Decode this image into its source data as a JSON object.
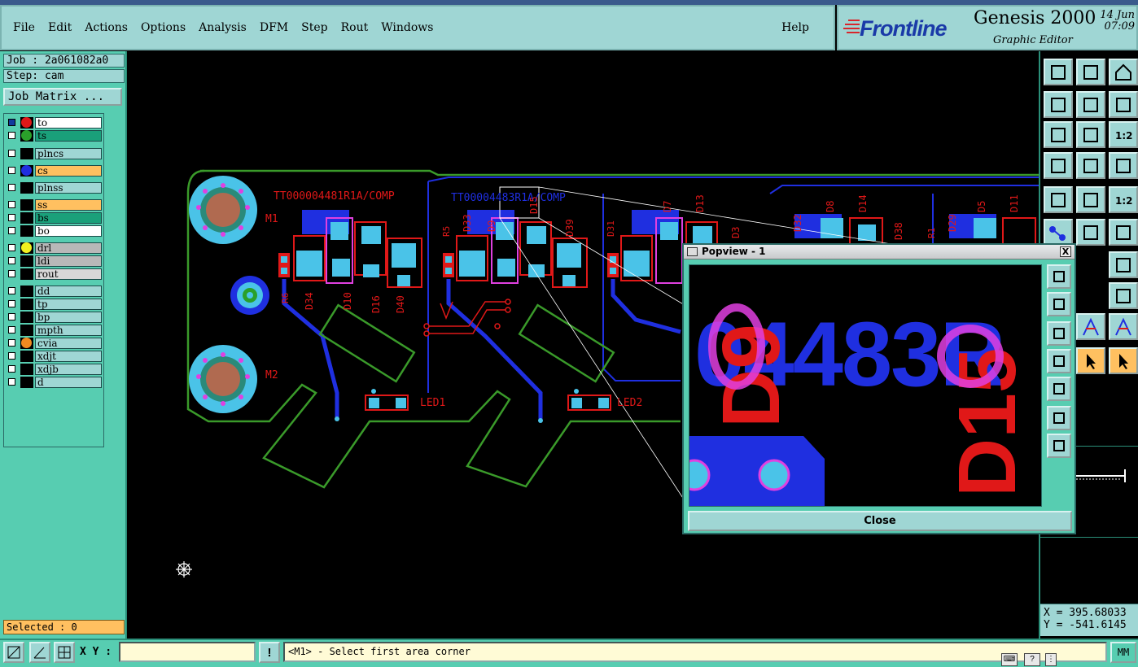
{
  "menu": {
    "items": [
      "File",
      "Edit",
      "Actions",
      "Options",
      "Analysis",
      "DFM",
      "Step",
      "Rout",
      "Windows"
    ],
    "help": "Help"
  },
  "brand": {
    "logo": "Frontline",
    "product": "Genesis 2000",
    "subtitle": "Graphic Editor",
    "date": "14 Jun",
    "time": "07:09"
  },
  "job": {
    "job_label": "Job : 2a061082a0",
    "step_label": "Step: cam",
    "matrix_button": "Job Matrix ..."
  },
  "layers": [
    {
      "name": "to",
      "bg": "#ffffff",
      "dot": "#e01818",
      "checked": true
    },
    {
      "name": "ts",
      "bg": "#1aa07a",
      "dot": "#2aa02a",
      "checked": false
    },
    {
      "name": "plncs",
      "bg": "#9fd6d4",
      "dot": "",
      "checked": false
    },
    {
      "name": "cs",
      "bg": "#ffc060",
      "dot": "#1f2fe0",
      "checked": false
    },
    {
      "name": "plnss",
      "bg": "#9fd6d4",
      "dot": "",
      "checked": false
    },
    {
      "name": "ss",
      "bg": "#ffc060",
      "dot": "",
      "checked": false
    },
    {
      "name": "bs",
      "bg": "#1aa07a",
      "dot": "",
      "checked": false
    },
    {
      "name": "bo",
      "bg": "#ffffff",
      "dot": "",
      "checked": false
    },
    {
      "name": "drl",
      "bg": "#b8b8b8",
      "dot": "#f0f020",
      "checked": false
    },
    {
      "name": "ldi",
      "bg": "#b8b8b8",
      "dot": "",
      "checked": false
    },
    {
      "name": "rout",
      "bg": "#d8d8d8",
      "dot": "",
      "checked": false
    },
    {
      "name": "dd",
      "bg": "#9fd6d4",
      "dot": "",
      "checked": false
    },
    {
      "name": "tp",
      "bg": "#9fd6d4",
      "dot": "",
      "checked": false
    },
    {
      "name": "bp",
      "bg": "#9fd6d4",
      "dot": "",
      "checked": false
    },
    {
      "name": "mpth",
      "bg": "#9fd6d4",
      "dot": "",
      "checked": false
    },
    {
      "name": "cvia",
      "bg": "#9fd6d4",
      "dot": "#f08a20",
      "checked": false
    },
    {
      "name": "xdjt",
      "bg": "#9fd6d4",
      "dot": "",
      "checked": false
    },
    {
      "name": "xdjb",
      "bg": "#9fd6d4",
      "dot": "",
      "checked": false
    },
    {
      "name": "d",
      "bg": "#9fd6d4",
      "dot": "",
      "checked": false
    }
  ],
  "selected": "Selected : 0",
  "board": {
    "labels": [
      "TT000004481R1A/COMP",
      "TT00004483R1A/COMP"
    ],
    "refs": [
      "M1",
      "M2",
      "R6",
      "D34",
      "D10",
      "D16",
      "D40",
      "R5",
      "D33",
      "D9",
      "D15",
      "D39",
      "D31",
      "D7",
      "D13",
      "D3",
      "D32",
      "D8",
      "D14",
      "D38",
      "R1",
      "D29",
      "D5",
      "D11",
      "LED1",
      "LED2"
    ]
  },
  "popup": {
    "title": "Popview - 1",
    "close_x": "X",
    "close_button": "Close",
    "zoom_text": "04483R",
    "zoom_refs": [
      "D9",
      "D15"
    ]
  },
  "coords": {
    "x": "X =  395.68033",
    "y": "Y = -541.6145"
  },
  "bottom": {
    "xy_label": "X Y :",
    "xy_value": "",
    "status": "<M1> - Select first area corner",
    "units": "MM"
  },
  "icons": [
    "zoom-home-icon",
    "fit-icon",
    "pan-icon",
    "measure-icon",
    "snap-icon",
    "highlight-icon",
    "cursor-icon"
  ]
}
